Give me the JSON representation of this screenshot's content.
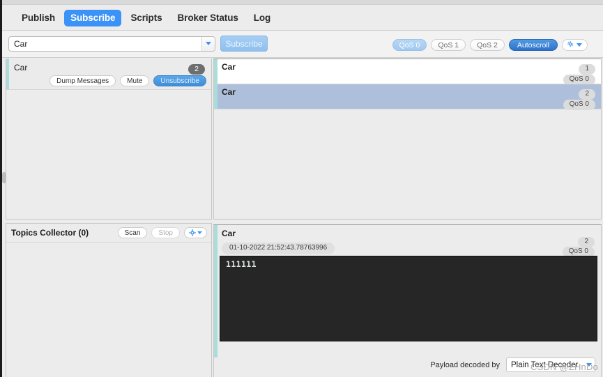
{
  "app": {
    "accent_blue": "#3b93f7",
    "accent_teal": "#aadcd8",
    "selected_row_bg": "#aebfdb",
    "payload_bg": "#262626"
  },
  "tabs": [
    {
      "label": "Publish",
      "active": false
    },
    {
      "label": "Subscribe",
      "active": true
    },
    {
      "label": "Scripts",
      "active": false
    },
    {
      "label": "Broker Status",
      "active": false
    },
    {
      "label": "Log",
      "active": false
    }
  ],
  "toolbar": {
    "topic_value": "Car",
    "topic_placeholder": "Topic",
    "subscribe_label": "Subscribe",
    "qos_buttons": [
      {
        "label": "QoS 0",
        "active": true
      },
      {
        "label": "QoS 1",
        "active": false
      },
      {
        "label": "QoS 2",
        "active": false
      }
    ],
    "autoscroll_label": "Autoscroll",
    "settings_icon": "gear-icon"
  },
  "subscriptions": {
    "items": [
      {
        "topic": "Car",
        "count": "2",
        "dump_label": "Dump Messages",
        "mute_label": "Mute",
        "unsubscribe_label": "Unsubscribe"
      }
    ]
  },
  "topics_collector": {
    "title": "Topics Collector (0)",
    "scan_label": "Scan",
    "stop_label": "Stop",
    "settings_icon": "gear-icon"
  },
  "messages": [
    {
      "topic": "Car",
      "count": "1",
      "qos": "QoS 0",
      "selected": false
    },
    {
      "topic": "Car",
      "count": "2",
      "qos": "QoS 0",
      "selected": true
    }
  ],
  "detail": {
    "topic": "Car",
    "count": "2",
    "qos": "QoS 0",
    "timestamp": "01-10-2022  21:52:43.78763996",
    "payload": "111111",
    "decoder_label": "Payload decoded by",
    "decoder_value": "Plain Text Decoder"
  },
  "watermark": {
    "text": "CSDN @ZHnDo"
  }
}
